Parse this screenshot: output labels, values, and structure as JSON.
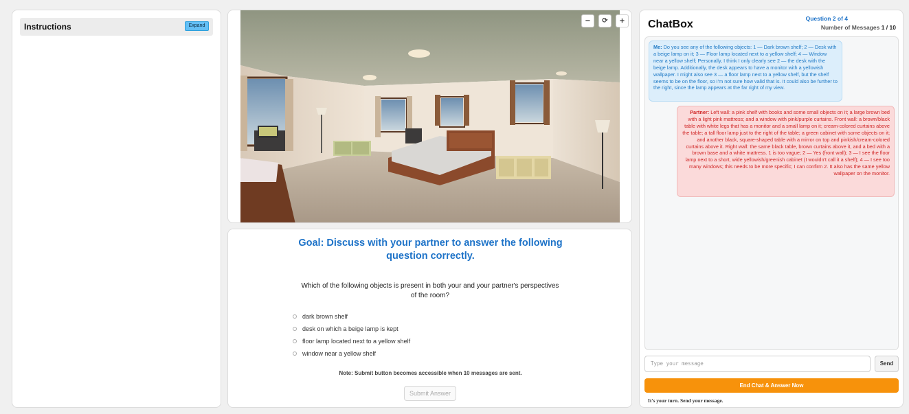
{
  "instructions": {
    "title": "Instructions",
    "expand_label": "Expand"
  },
  "scene": {
    "zoom_out_label": "−",
    "reset_label": "⟳",
    "zoom_in_label": "+"
  },
  "goal": {
    "title_line1": "Goal: Discuss with your partner to answer the following",
    "title_line2": "question correctly.",
    "question_line1": "Which of the following objects is present in both your and your partner's perspectives",
    "question_line2": "of the room?",
    "options": [
      "dark brown shelf",
      "desk on which a beige lamp is kept",
      "floor lamp located next to a yellow shelf",
      "window near a yellow shelf"
    ],
    "note": "Note: Submit button becomes accessible when 10 messages are sent.",
    "submit_label": "Submit Answer"
  },
  "chat": {
    "title": "ChatBox",
    "question_progress": "Question 2 of 4",
    "messages_label": "Number of Messages",
    "messages_count": "1 / 10",
    "messages": [
      {
        "sender": "Me:",
        "text": "Do you see any of the following objects: 1 — Dark brown shelf; 2 — Desk with a beige lamp on it; 3 — Floor lamp located next to a yellow shelf; 4 — Window near a yellow shelf; Personally, I think I only clearly see 2 — the desk with the beige lamp. Additionally, the desk appears to have a monitor with a yellowish wallpaper. I might also see 3 — a floor lamp next to a yellow shelf, but the shelf seems to be on the floor, so I'm not sure how valid that is. It could also be further to the right, since the lamp appears at the far right of my view."
      },
      {
        "sender": "Partner:",
        "text": "Left wall: a pink shelf with books and some small objects on it; a large brown bed with a light pink mattress; and a window with pink/purple curtains. Front wall: a brown/black table with white legs that has a monitor and a small lamp on it; cream-colored curtains above the table; a tall floor lamp just to the right of the table; a green cabinet with some objects on it; and another black, square-shaped table with a mirror on top and pinkish/cream-colored curtains above it. Right wall: the same black table, brown curtains above it, and a bed with a brown base and a white mattress. 1 is too vague; 2 — Yes (front wall); 3 — I see the floor lamp next to a short, wide yellowish/greenish cabinet (I wouldn't call it a shelf); 4 — I see too many windows; this needs to be more specific; I can confirm 2. It also has the same yellow wallpaper on the monitor."
      }
    ],
    "input_placeholder": "Type your message",
    "send_label": "Send",
    "end_label": "End Chat & Answer Now",
    "turn_text": "It's your turn. Send your message."
  }
}
